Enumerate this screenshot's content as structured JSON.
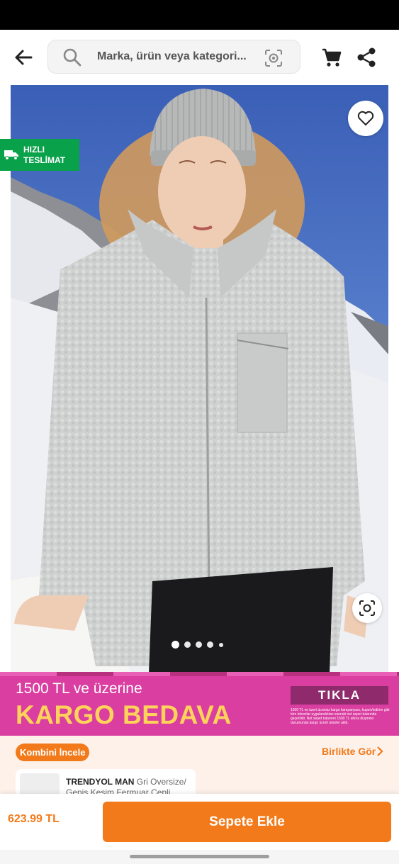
{
  "search": {
    "placeholder": "Marka, ürün veya kategori..."
  },
  "header": {
    "back_icon": "arrow-left-icon",
    "search_icon": "search-icon",
    "visual_search_icon": "camera-lens-icon",
    "cart_icon": "cart-icon",
    "share_icon": "share-icon"
  },
  "gallery": {
    "badge_line1": "HIZLI",
    "badge_line2": "TESLİMAT",
    "image_count": 5,
    "active_index": 0,
    "favorite_icon": "heart-icon",
    "visual_search_icon": "lens-icon"
  },
  "banner": {
    "line1": "1500 TL ve üzerine",
    "line2": "KARGO BEDAVA",
    "cta": "TIKLA",
    "fine_print": "1500 TL ve üzeri ücretsiz kargo kampanyası, kupon/indirim gibi tüm tekrarlar uygulandıktan sonraki net sepet tutarında geçerlidir. Net sepet tutarının 1500 TL altına düşmesi durumunda kargo ücreti ürünler aittir."
  },
  "combo": {
    "pill": "Kombini İncele",
    "see_together": "Birlikte Gör",
    "card_brand": "TRENDYOL MAN",
    "card_desc": "Gri Oversize/ Geniş Kesim Fermuar Cepli"
  },
  "bottom": {
    "price": "623.99 TL",
    "add_to_cart": "Sepete Ekle"
  },
  "colors": {
    "accent": "#f27a1a",
    "badge_green": "#0aa14b",
    "banner_pink": "#d93ea0",
    "banner_yellow": "#ffd35a"
  }
}
